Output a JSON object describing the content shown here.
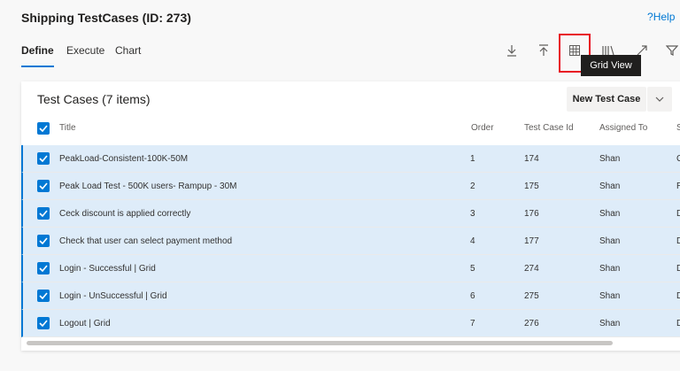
{
  "page": {
    "title": "Shipping TestCases (ID: 273)",
    "help": "Help"
  },
  "tabs": [
    {
      "label": "Define"
    },
    {
      "label": "Execute"
    },
    {
      "label": "Chart"
    }
  ],
  "toolbar": {
    "icons": [
      "export-icon",
      "import-icon",
      "grid-icon",
      "columns-icon",
      "expand-icon",
      "filter-icon"
    ],
    "tooltip": "Grid View"
  },
  "card": {
    "title": "Test Cases (7 items)",
    "new_button": "New Test Case",
    "columns": [
      "Title",
      "Order",
      "Test Case Id",
      "Assigned To",
      "S"
    ],
    "rows": [
      {
        "title": "PeakLoad-Consistent-100K-50M",
        "order": "1",
        "id": "174",
        "assigned": "Shan",
        "state": "C"
      },
      {
        "title": "Peak Load Test - 500K users- Rampup - 30M",
        "order": "2",
        "id": "175",
        "assigned": "Shan",
        "state": "R"
      },
      {
        "title": "Ceck discount is applied correctly",
        "order": "3",
        "id": "176",
        "assigned": "Shan",
        "state": "D"
      },
      {
        "title": "Check that user can select payment method",
        "order": "4",
        "id": "177",
        "assigned": "Shan",
        "state": "D"
      },
      {
        "title": "Login - Successful | Grid",
        "order": "5",
        "id": "274",
        "assigned": "Shan",
        "state": "D"
      },
      {
        "title": "Login - UnSuccessful | Grid",
        "order": "6",
        "id": "275",
        "assigned": "Shan",
        "state": "D"
      },
      {
        "title": "Logout | Grid",
        "order": "7",
        "id": "276",
        "assigned": "Shan",
        "state": "D"
      }
    ]
  },
  "colors": {
    "accent": "#0078d4",
    "selected_row": "#deecf9",
    "highlight": "#e81123"
  }
}
